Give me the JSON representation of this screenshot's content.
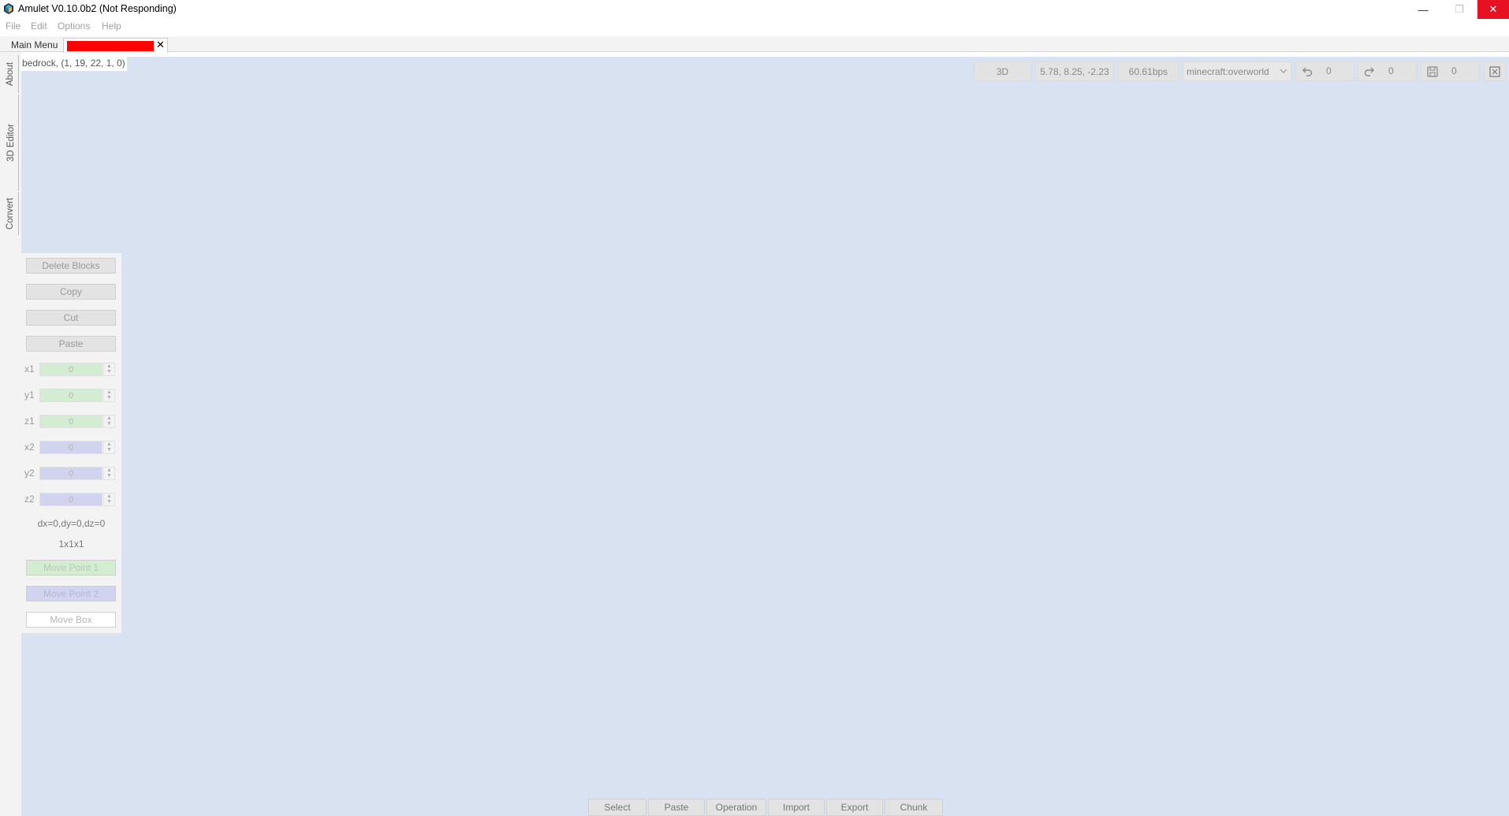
{
  "window": {
    "title": "Amulet V0.10.0b2 (Not Responding)",
    "minimize_glyph": "—",
    "maximize_glyph": "❐",
    "close_glyph": "✕"
  },
  "menu": [
    "File",
    "Edit",
    "Options",
    "Help"
  ],
  "tabs": {
    "main_menu": "Main Menu",
    "close_glyph": "✕"
  },
  "side_tabs": [
    "About",
    "3D Editor",
    "Convert"
  ],
  "cursor_info": "bedrock, (1, 19, 22, 1, 0)",
  "toolbar": {
    "view_mode": "3D",
    "camera_position": "5.78, 8.25, -2.23",
    "speed": "60.61bps",
    "dimension": "minecraft:overworld",
    "undo_count": "0",
    "redo_count": "0",
    "save_count": "0"
  },
  "panel": {
    "buttons": [
      "Delete Blocks",
      "Copy",
      "Cut",
      "Paste"
    ],
    "coords": [
      {
        "label": "x1",
        "value": "0"
      },
      {
        "label": "y1",
        "value": "0"
      },
      {
        "label": "z1",
        "value": "0"
      },
      {
        "label": "x2",
        "value": "0"
      },
      {
        "label": "y2",
        "value": "0"
      },
      {
        "label": "z2",
        "value": "0"
      }
    ],
    "delta": "dx=0,dy=0,dz=0",
    "size": "1x1x1",
    "move_point_1": "Move Point 1",
    "move_point_2": "Move Point 2",
    "move_box": "Move Box"
  },
  "bottom_tools": [
    "Select",
    "Paste",
    "Operation",
    "Import",
    "Export",
    "Chunk"
  ],
  "colors": {
    "canvas": "#d8e2f0",
    "point1": "#d4ecd1",
    "point2": "#d2d3ee",
    "close_red": "#e81123",
    "world_tab_redacted": "#ff0000"
  }
}
